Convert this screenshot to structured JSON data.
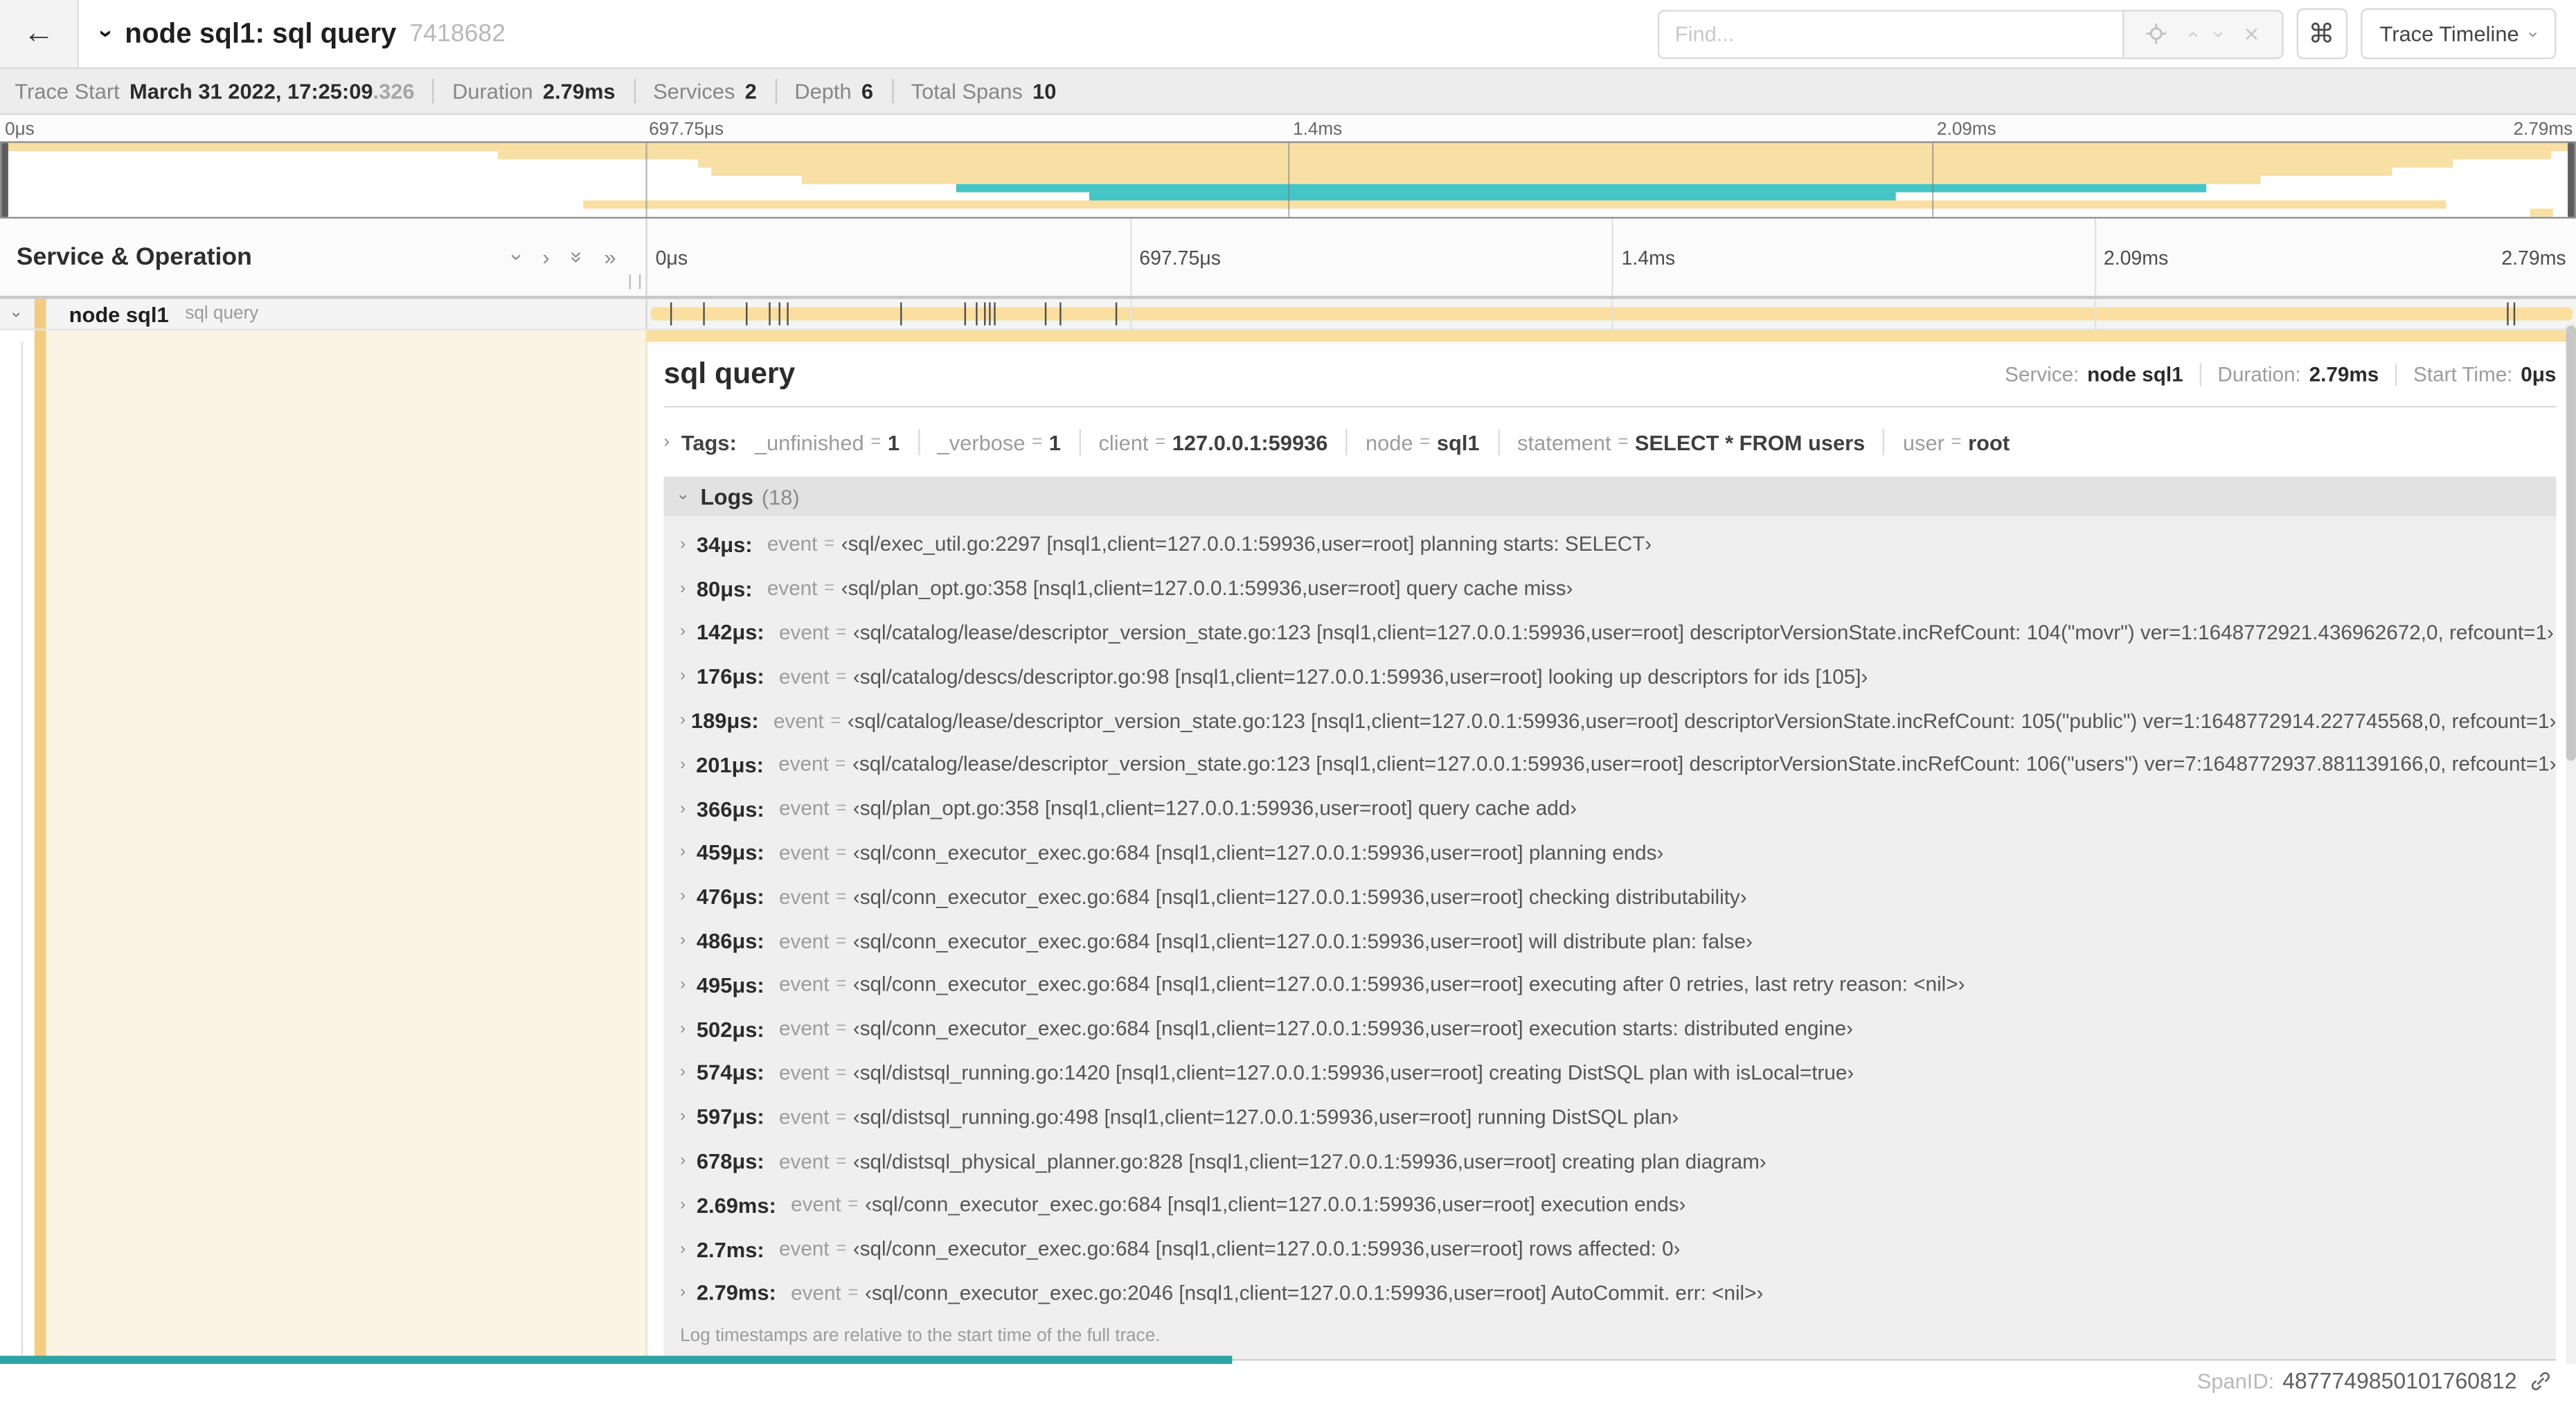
{
  "icons": {
    "back": "←",
    "chevron": "›",
    "double_chevron": "»",
    "close": "✕",
    "command": "⌘",
    "equals": "="
  },
  "header": {
    "title": "node sql1: sql query",
    "trace_id": "7418682",
    "find_placeholder": "Find...",
    "view_selector": "Trace Timeline"
  },
  "summary": {
    "items": [
      {
        "label": "Trace Start",
        "value": "March 31 2022, 17:25:09",
        "suffix": ".326"
      },
      {
        "label": "Duration",
        "value": "2.79ms"
      },
      {
        "label": "Services",
        "value": "2"
      },
      {
        "label": "Depth",
        "value": "6"
      },
      {
        "label": "Total Spans",
        "value": "10"
      }
    ]
  },
  "minimap": {
    "ticks": [
      "0μs",
      "697.75μs",
      "1.4ms",
      "2.09ms",
      "2.79ms"
    ],
    "tick_positions": [
      0,
      25,
      50,
      75,
      100
    ],
    "colors": {
      "tan": "#f8dfa3",
      "teal": "#44c5c5"
    },
    "bars": [
      {
        "s": 0,
        "e": 100,
        "c": "tan"
      },
      {
        "s": 19.3,
        "e": 99.1,
        "c": "tan"
      },
      {
        "s": 27.1,
        "e": 95.3,
        "c": "tan"
      },
      {
        "s": 27.6,
        "e": 92.9,
        "c": "tan"
      },
      {
        "s": 31.1,
        "e": 87.8,
        "c": "tan"
      },
      {
        "s": 37.1,
        "e": 85.7,
        "c": "teal"
      },
      {
        "s": 42.3,
        "e": 73.6,
        "c": "teal"
      },
      {
        "s": 22.6,
        "e": 95.0,
        "c": "tan"
      },
      {
        "s": 98.3,
        "e": 99.2,
        "c": "tan"
      }
    ]
  },
  "timeline": {
    "left_header": "Service & Operation",
    "ticks": [
      "0μs",
      "697.75μs",
      "1.4ms",
      "2.09ms",
      "2.79ms"
    ],
    "duration_us": 2790,
    "row": {
      "service": "node sql1",
      "operation": "sql query"
    }
  },
  "detail": {
    "title": "sql query",
    "meta": [
      {
        "label": "Service:",
        "value": "node sql1"
      },
      {
        "label": "Duration:",
        "value": "2.79ms"
      },
      {
        "label": "Start Time:",
        "value": "0μs"
      }
    ],
    "tags_label": "Tags:",
    "tags": [
      {
        "key": "_unfinished",
        "value": "1"
      },
      {
        "key": "_verbose",
        "value": "1"
      },
      {
        "key": "client",
        "value": "127.0.0.1:59936"
      },
      {
        "key": "node",
        "value": "sql1"
      },
      {
        "key": "statement",
        "value": "SELECT * FROM users"
      },
      {
        "key": "user",
        "value": "root"
      }
    ],
    "logs_label": "Logs",
    "logs_count": "(18)",
    "log_field_label": "event",
    "logs": [
      {
        "time": "34μs:",
        "t_us": 34,
        "value": "‹sql/exec_util.go:2297 [nsql1,client=127.0.0.1:59936,user=root] planning starts: SELECT›"
      },
      {
        "time": "80μs:",
        "t_us": 80,
        "value": "‹sql/plan_opt.go:358 [nsql1,client=127.0.0.1:59936,user=root] query cache miss›"
      },
      {
        "time": "142μs:",
        "t_us": 142,
        "value": "‹sql/catalog/lease/descriptor_version_state.go:123 [nsql1,client=127.0.0.1:59936,user=root] descriptorVersionState.incRefCount: 104(\"movr\") ver=1:1648772921.436962672,0, refcount=1›"
      },
      {
        "time": "176μs:",
        "t_us": 176,
        "value": "‹sql/catalog/descs/descriptor.go:98 [nsql1,client=127.0.0.1:59936,user=root] looking up descriptors for ids [105]›"
      },
      {
        "time": "189μs:",
        "t_us": 189,
        "value": "‹sql/catalog/lease/descriptor_version_state.go:123 [nsql1,client=127.0.0.1:59936,user=root] descriptorVersionState.incRefCount: 105(\"public\") ver=1:1648772914.227745568,0, refcount=1›"
      },
      {
        "time": "201μs:",
        "t_us": 201,
        "value": "‹sql/catalog/lease/descriptor_version_state.go:123 [nsql1,client=127.0.0.1:59936,user=root] descriptorVersionState.incRefCount: 106(\"users\") ver=7:1648772937.881139166,0, refcount=1›"
      },
      {
        "time": "366μs:",
        "t_us": 366,
        "value": "‹sql/plan_opt.go:358 [nsql1,client=127.0.0.1:59936,user=root] query cache add›"
      },
      {
        "time": "459μs:",
        "t_us": 459,
        "value": "‹sql/conn_executor_exec.go:684 [nsql1,client=127.0.0.1:59936,user=root] planning ends›"
      },
      {
        "time": "476μs:",
        "t_us": 476,
        "value": "‹sql/conn_executor_exec.go:684 [nsql1,client=127.0.0.1:59936,user=root] checking distributability›"
      },
      {
        "time": "486μs:",
        "t_us": 486,
        "value": "‹sql/conn_executor_exec.go:684 [nsql1,client=127.0.0.1:59936,user=root] will distribute plan: false›"
      },
      {
        "time": "495μs:",
        "t_us": 495,
        "value": "‹sql/conn_executor_exec.go:684 [nsql1,client=127.0.0.1:59936,user=root] executing after 0 retries, last retry reason: <nil>›"
      },
      {
        "time": "502μs:",
        "t_us": 502,
        "value": "‹sql/conn_executor_exec.go:684 [nsql1,client=127.0.0.1:59936,user=root] execution starts: distributed engine›"
      },
      {
        "time": "574μs:",
        "t_us": 574,
        "value": "‹sql/distsql_running.go:1420 [nsql1,client=127.0.0.1:59936,user=root] creating DistSQL plan with isLocal=true›"
      },
      {
        "time": "597μs:",
        "t_us": 597,
        "value": "‹sql/distsql_running.go:498 [nsql1,client=127.0.0.1:59936,user=root] running DistSQL plan›"
      },
      {
        "time": "678μs:",
        "t_us": 678,
        "value": "‹sql/distsql_physical_planner.go:828 [nsql1,client=127.0.0.1:59936,user=root] creating plan diagram›"
      },
      {
        "time": "2.69ms:",
        "t_us": 2690,
        "value": "‹sql/conn_executor_exec.go:684 [nsql1,client=127.0.0.1:59936,user=root] execution ends›"
      },
      {
        "time": "2.7ms:",
        "t_us": 2700,
        "value": "‹sql/conn_executor_exec.go:684 [nsql1,client=127.0.0.1:59936,user=root] rows affected: 0›"
      },
      {
        "time": "2.79ms:",
        "t_us": 2790,
        "value": "‹sql/conn_executor_exec.go:2046 [nsql1,client=127.0.0.1:59936,user=root] AutoCommit. err: <nil>›"
      }
    ],
    "logs_note": "Log timestamps are relative to the start time of the full trace.",
    "span_id_label": "SpanID:",
    "span_id": "4877749850101760812"
  }
}
